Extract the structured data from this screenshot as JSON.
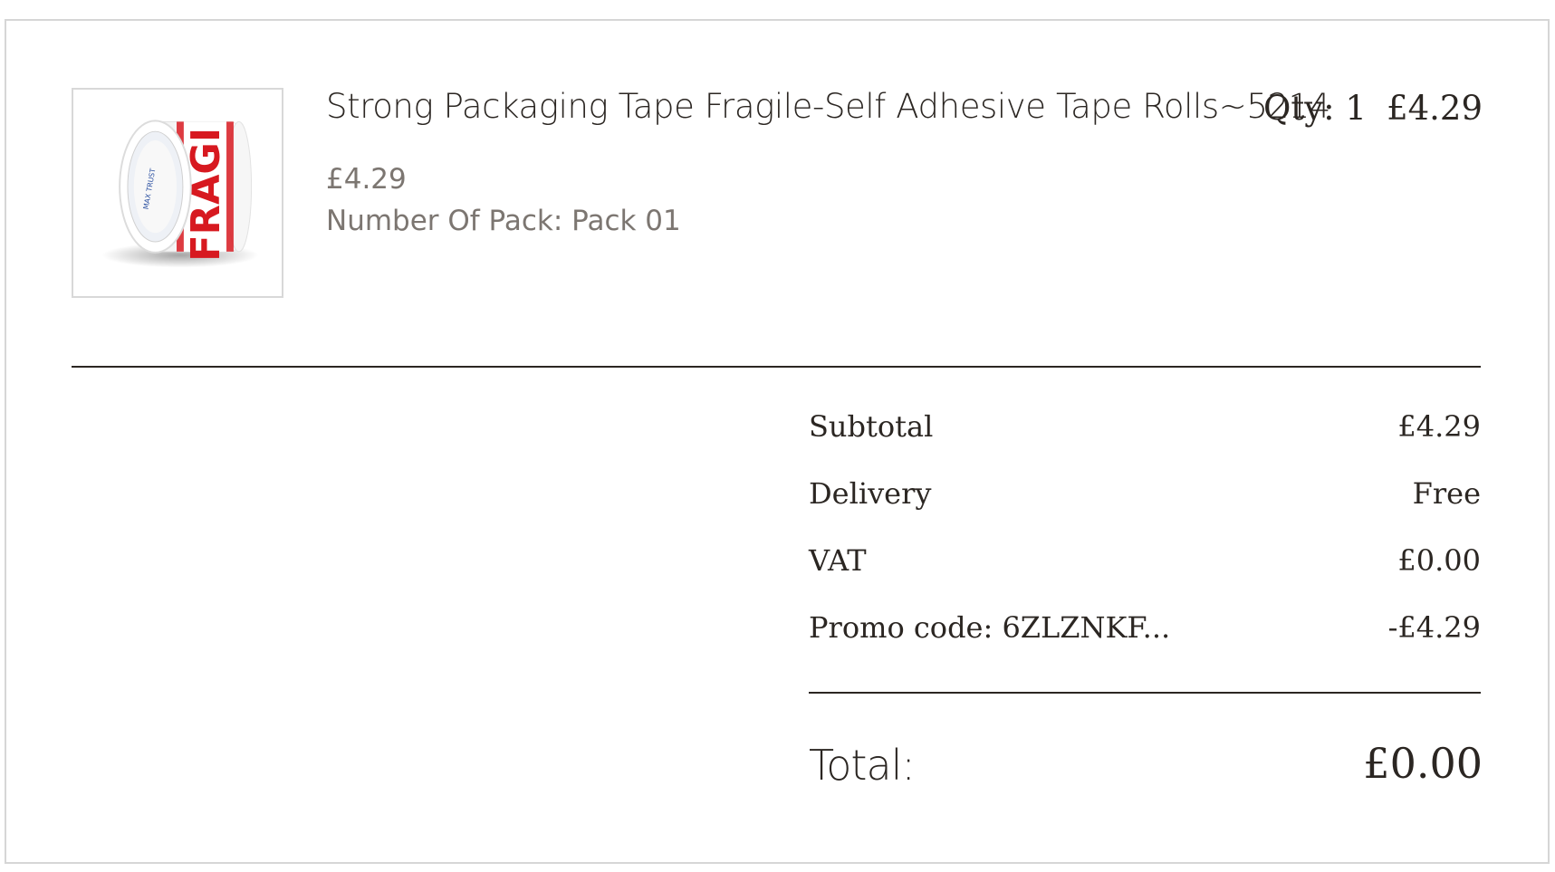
{
  "item": {
    "title": "Strong Packaging Tape Fragile-Self Adhesive Tape Rolls~5214",
    "unit_price": "£4.29",
    "variant": "Number Of Pack: Pack 01",
    "quantity": "Qty: 1",
    "line_price": "£4.29",
    "image": {
      "tape_text": "FRAGI",
      "core_text": "MAX TRUST",
      "accent_color": "#d71920"
    }
  },
  "summary": {
    "subtotal_label": "Subtotal",
    "subtotal_value": "£4.29",
    "delivery_label": "Delivery",
    "delivery_value": "Free",
    "vat_label": "VAT",
    "vat_value": "£0.00",
    "promo_label": "Promo code: 6ZLZNKF...",
    "promo_value": "-£4.29",
    "total_label": "Total:",
    "total_value": "£0.00"
  },
  "colors": {
    "text": "#2b2622",
    "muted": "#7c7671",
    "border": "#d6d6d6"
  }
}
